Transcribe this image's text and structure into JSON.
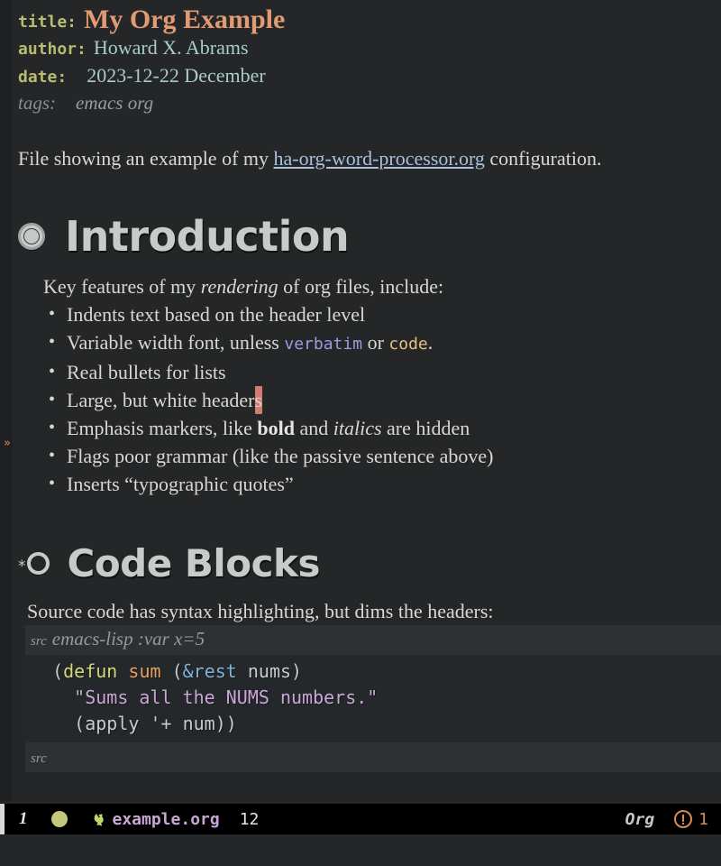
{
  "document": {
    "metadata": [
      {
        "key": "title:",
        "value": "My Org Example",
        "style": "title"
      },
      {
        "key": "author:",
        "value": "Howard X. Abrams",
        "style": "value"
      },
      {
        "key": "date:",
        "value": "2023-12-22 December",
        "style": "value"
      },
      {
        "key": "tags:",
        "value": "emacs org",
        "style": "tags"
      }
    ],
    "intro_paragraph": {
      "before_link": "File showing an example of my ",
      "link_text": "ha-org-word-processor.org",
      "after_link": " configuration."
    },
    "sections": [
      {
        "id": "introduction",
        "heading": "Introduction",
        "bullet": "filled-ring-bullet",
        "level": 1,
        "lead_in": {
          "before_em": "Key features of my ",
          "em": "rendering",
          "after_em": " of org files, include:"
        },
        "list_items": [
          {
            "text": "Indents text based on the header level"
          },
          {
            "text": "Variable width font, unless verbatim or code.",
            "parts": [
              {
                "t": "Variable width font, unless ",
                "s": "plain"
              },
              {
                "t": "verbatim",
                "s": "verbatim"
              },
              {
                "t": " or ",
                "s": "plain"
              },
              {
                "t": "code",
                "s": "code"
              },
              {
                "t": ".",
                "s": "plain"
              }
            ]
          },
          {
            "text": "Real bullets for lists"
          },
          {
            "text": "Large, but white headers",
            "parts": [
              {
                "t": "Large, but white header",
                "s": "plain"
              },
              {
                "t": "s",
                "s": "cursor"
              }
            ]
          },
          {
            "text": "Emphasis markers, like bold and italics are hidden",
            "parts": [
              {
                "t": "Emphasis markers, like ",
                "s": "plain"
              },
              {
                "t": "bold",
                "s": "bold"
              },
              {
                "t": " and ",
                "s": "plain"
              },
              {
                "t": "italics",
                "s": "italic-flagged"
              },
              {
                "t": " are hidden",
                "s": "plain"
              }
            ]
          },
          {
            "text": "Flags poor grammar (like the passive sentence above)"
          },
          {
            "text": "Inserts “typographic quotes”"
          }
        ]
      },
      {
        "id": "code-blocks",
        "heading": "Code Blocks",
        "bullet": "star-hollow-ring-bullet",
        "level": 2,
        "lead_in_text": "Source code has syntax highlighting, but dims the headers:",
        "src_block": {
          "begin_tag": "src",
          "begin_args": "emacs-lisp :var x=5",
          "end_tag": "src",
          "language": "emacs-lisp",
          "lines": [
            {
              "indent": "  ",
              "tokens": [
                {
                  "t": "(",
                  "s": "plain"
                },
                {
                  "t": "defun",
                  "s": "keyword"
                },
                {
                  "t": " ",
                  "s": "plain"
                },
                {
                  "t": "sum",
                  "s": "function-name"
                },
                {
                  "t": " (",
                  "s": "plain"
                },
                {
                  "t": "&rest",
                  "s": "ampersand"
                },
                {
                  "t": " nums)",
                  "s": "plain"
                }
              ]
            },
            {
              "indent": "    ",
              "tokens": [
                {
                  "t": "\"Sums all the NUMS numbers.\"",
                  "s": "string"
                }
              ]
            },
            {
              "indent": "    ",
              "tokens": [
                {
                  "t": "(apply '+ num))",
                  "s": "plain"
                }
              ]
            }
          ]
        }
      }
    ],
    "fringe_marker": "»"
  },
  "modeline": {
    "window_number": "1",
    "status_dot": "modified-indicator",
    "logo_icon": "gnu-head-icon",
    "buffer_name": "example.org",
    "position": "12",
    "major_mode": "Org",
    "warning_icon": "exclamation-circle-icon",
    "warning_count": "1"
  },
  "colors": {
    "background": "#242628",
    "fringe": "#1e2022",
    "foreground": "#d8d8d4",
    "keyword": "#b9bc6e",
    "title": "#e19a71",
    "meta_value": "#a9cdc5",
    "tags": "#9a9c9e",
    "link": "#a9c1dd",
    "heading": "#c9cbc8",
    "verbatim": "#9c9ce0",
    "code": "#e8c07d",
    "cursor": "#d47c72",
    "src_header_bg": "#2e3134",
    "src_body_bg": "#25282b",
    "modeline_bg": "#000000",
    "modeline_file": "#c9a6d6",
    "modeline_dot": "#c3c87a",
    "warning": "#d88a50",
    "fringe_arrow": "#d08b5e"
  }
}
